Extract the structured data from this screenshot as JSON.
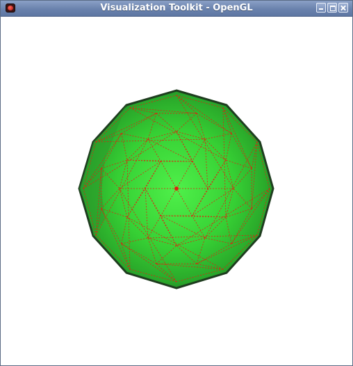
{
  "window": {
    "title": "Visualization Toolkit - OpenGL",
    "icon": "vtk-app-icon",
    "controls": [
      "minimize-icon",
      "maximize-icon",
      "close-icon"
    ]
  },
  "render": {
    "background_color": "#ffffff",
    "surface_color": "#3bd83b",
    "wireframe_color": "#e02010",
    "outline_color": "#1f3d1f"
  }
}
